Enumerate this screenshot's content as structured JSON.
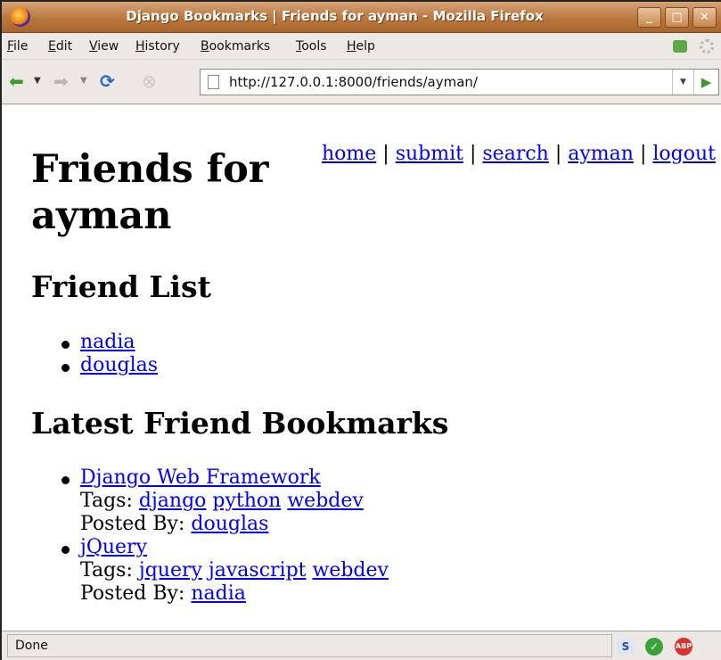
{
  "window": {
    "title": "Django Bookmarks | Friends for ayman - Mozilla Firefox"
  },
  "menubar": {
    "items": [
      "File",
      "Edit",
      "View",
      "History",
      "Bookmarks",
      "Tools",
      "Help"
    ]
  },
  "navbar": {
    "url": "http://127.0.0.1:8000/friends/ayman/"
  },
  "page": {
    "nav_links": [
      "home",
      "submit",
      "search",
      "ayman",
      "logout"
    ],
    "nav_separator": "|",
    "title": "Friends for ayman",
    "friend_list_heading": "Friend List",
    "friends": [
      "nadia",
      "douglas"
    ],
    "latest_heading": "Latest Friend Bookmarks",
    "bookmarks": [
      {
        "title": "Django Web Framework",
        "tags_label": "Tags:",
        "tags": [
          "django",
          "python",
          "webdev"
        ],
        "posted_by_label": "Posted By:",
        "posted_by": "douglas"
      },
      {
        "title": "jQuery",
        "tags_label": "Tags:",
        "tags": [
          "jquery",
          "javascript",
          "webdev"
        ],
        "posted_by_label": "Posted By:",
        "posted_by": "nadia"
      }
    ]
  },
  "statusbar": {
    "text": "Done"
  },
  "icons": {
    "firefox": "firefox-icon",
    "back": "back-arrow-icon",
    "forward": "forward-arrow-icon",
    "reload": "reload-icon",
    "stop": "stop-icon",
    "go": "go-arrow-icon"
  },
  "colors": {
    "link": "#0000ee",
    "titlebar": "#b9773e"
  }
}
